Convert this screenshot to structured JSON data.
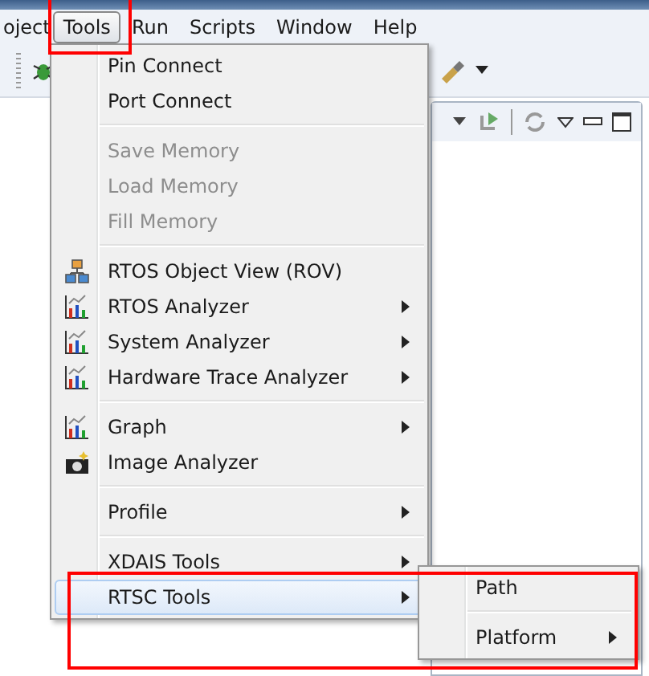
{
  "menubar": [
    {
      "label": "oject",
      "selected": false
    },
    {
      "label": "Tools",
      "selected": true
    },
    {
      "label": "Run",
      "selected": false
    },
    {
      "label": "Scripts",
      "selected": false
    },
    {
      "label": "Window",
      "selected": false
    },
    {
      "label": "Help",
      "selected": false
    }
  ],
  "menu": [
    {
      "kind": "text",
      "label": "Pin Connect",
      "disabled": false,
      "submenu": false,
      "selected": false
    },
    {
      "kind": "text",
      "label": "Port Connect",
      "disabled": false,
      "submenu": false,
      "selected": false
    },
    {
      "kind": "separator"
    },
    {
      "kind": "text",
      "label": "Save Memory",
      "disabled": true,
      "submenu": false,
      "selected": false
    },
    {
      "kind": "text",
      "label": "Load Memory",
      "disabled": true,
      "submenu": false,
      "selected": false
    },
    {
      "kind": "text",
      "label": "Fill Memory",
      "disabled": true,
      "submenu": false,
      "selected": false
    },
    {
      "kind": "separator"
    },
    {
      "kind": "viewer",
      "label": "RTOS Object View (ROV)",
      "disabled": false,
      "submenu": false,
      "selected": false
    },
    {
      "kind": "analyzer",
      "label": "RTOS Analyzer",
      "disabled": false,
      "submenu": true,
      "selected": false
    },
    {
      "kind": "analyzer",
      "label": "System Analyzer",
      "disabled": false,
      "submenu": true,
      "selected": false
    },
    {
      "kind": "analyzer",
      "label": "Hardware Trace Analyzer",
      "disabled": false,
      "submenu": true,
      "selected": false
    },
    {
      "kind": "separator"
    },
    {
      "kind": "analyzer",
      "label": "Graph",
      "disabled": false,
      "submenu": true,
      "selected": false
    },
    {
      "kind": "imager",
      "label": "Image Analyzer",
      "disabled": false,
      "submenu": false,
      "selected": false
    },
    {
      "kind": "separator"
    },
    {
      "kind": "text",
      "label": "Profile",
      "disabled": false,
      "submenu": true,
      "selected": false
    },
    {
      "kind": "separator"
    },
    {
      "kind": "text",
      "label": "XDAIS Tools",
      "disabled": false,
      "submenu": true,
      "selected": false
    },
    {
      "kind": "text",
      "label": "RTSC Tools",
      "disabled": false,
      "submenu": true,
      "selected": true
    }
  ],
  "submenu": [
    {
      "kind": "text",
      "label": "Path",
      "submenu": false,
      "selected": false
    },
    {
      "kind": "separator"
    },
    {
      "kind": "text",
      "label": "Platform",
      "submenu": true,
      "selected": false
    }
  ]
}
